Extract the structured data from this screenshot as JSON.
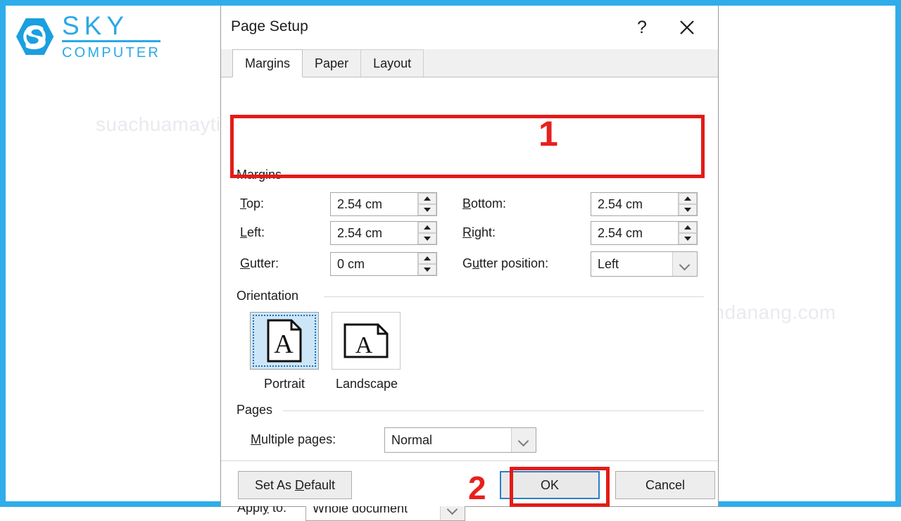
{
  "brand": {
    "name_line1": "SKY",
    "name_line2": "COMPUTER",
    "color": "#2aa9e5"
  },
  "watermark": {
    "text": "suachuamaytinhdanang.com"
  },
  "dialog": {
    "title": "Page Setup",
    "help_label": "?",
    "close_label": "✕",
    "tabs": [
      {
        "label": "Margins",
        "active": true
      },
      {
        "label": "Paper",
        "active": false
      },
      {
        "label": "Layout",
        "active": false
      }
    ],
    "groups": {
      "margins": {
        "title": "Margins",
        "fields": {
          "top": {
            "label": "Top:",
            "value": "2.54 cm"
          },
          "bottom": {
            "label": "Bottom:",
            "value": "2.54 cm"
          },
          "left": {
            "label": "Left:",
            "value": "2.54 cm"
          },
          "right": {
            "label": "Right:",
            "value": "2.54 cm"
          },
          "gutter": {
            "label": "Gutter:",
            "value": "0 cm"
          },
          "gutter_position": {
            "label": "Gutter position:",
            "value": "Left"
          }
        }
      },
      "orientation": {
        "title": "Orientation",
        "portrait_label": "Portrait",
        "landscape_label": "Landscape",
        "selected": "Portrait"
      },
      "pages": {
        "title": "Pages",
        "multiple_pages_label": "Multiple pages:",
        "multiple_pages_value": "Normal"
      }
    },
    "apply_to": {
      "label": "Apply to:",
      "value": "Whole document"
    },
    "buttons": {
      "set_as_default": "Set As Default",
      "ok": "OK",
      "cancel": "Cancel"
    }
  },
  "annotations": {
    "step1": "1",
    "step2": "2",
    "color": "#e31b17"
  }
}
